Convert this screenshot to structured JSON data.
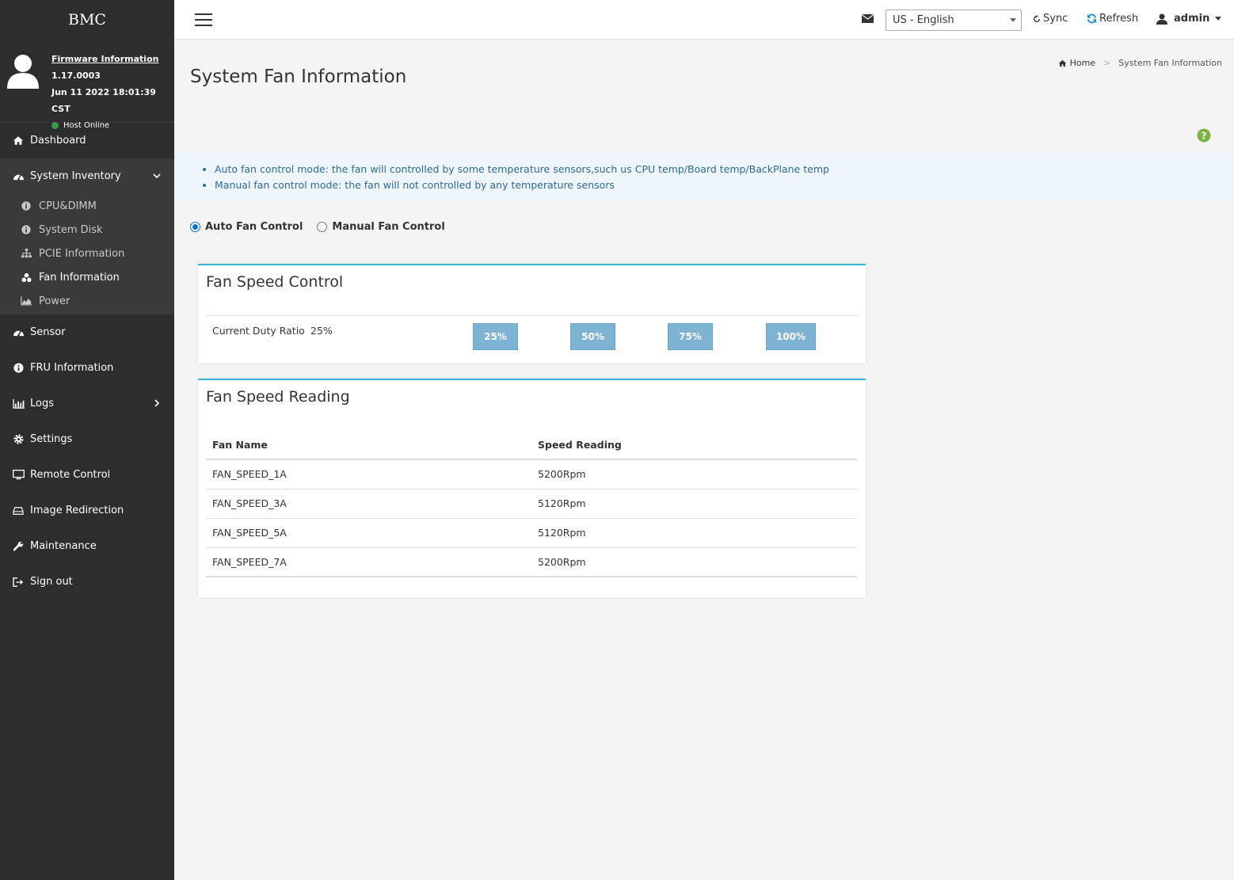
{
  "sidebar": {
    "brand": "BMC",
    "firmware": {
      "link_label": "Firmware Information",
      "version": "1.17.0003",
      "datetime": "Jun 11 2022 18:01:39 CST",
      "host_status": "Host Online",
      "host_status_color": "#3a9a4a"
    },
    "nav": {
      "dashboard": "Dashboard",
      "system_inventory": "System Inventory",
      "sub": {
        "cpu_dimm": "CPU&DIMM",
        "system_disk": "System Disk",
        "pcie": "PCIE Information",
        "fan": "Fan Information",
        "power": "Power"
      },
      "sensor": "Sensor",
      "fru": "FRU Information",
      "logs": "Logs",
      "settings": "Settings",
      "remote_control": "Remote Control",
      "image_redirection": "Image Redirection",
      "maintenance": "Maintenance",
      "sign_out": "Sign out"
    }
  },
  "topbar": {
    "language": "US - English",
    "sync": "Sync",
    "refresh": "Refresh",
    "user": "admin"
  },
  "page": {
    "title": "System Fan Information",
    "breadcrumb": {
      "home": "Home",
      "current": "System Fan Information"
    },
    "info": [
      "Auto fan control mode: the fan will controlled by some temperature sensors,such us CPU temp/Board temp/BackPlane temp",
      "Manual fan control mode: the fan will not controlled by any temperature sensors"
    ],
    "modes": {
      "auto": "Auto Fan Control",
      "manual": "Manual Fan Control",
      "selected": "auto"
    }
  },
  "fan_control": {
    "title": "Fan Speed Control",
    "duty_label": "Current Duty Ratio",
    "duty_value": "25%",
    "buttons": [
      "25%",
      "50%",
      "75%",
      "100%"
    ]
  },
  "fan_reading": {
    "title": "Fan Speed Reading",
    "columns": [
      "Fan Name",
      "Speed Reading"
    ],
    "rows": [
      [
        "FAN_SPEED_1A",
        "5200Rpm"
      ],
      [
        "FAN_SPEED_3A",
        "5120Rpm"
      ],
      [
        "FAN_SPEED_5A",
        "5120Rpm"
      ],
      [
        "FAN_SPEED_7A",
        "5200Rpm"
      ]
    ]
  },
  "colors": {
    "sidebar_bg": "#2d2d2d",
    "accent": "#3bb7d6",
    "duty_button": "#7fb3d4",
    "info_text": "#2b6a9a"
  }
}
